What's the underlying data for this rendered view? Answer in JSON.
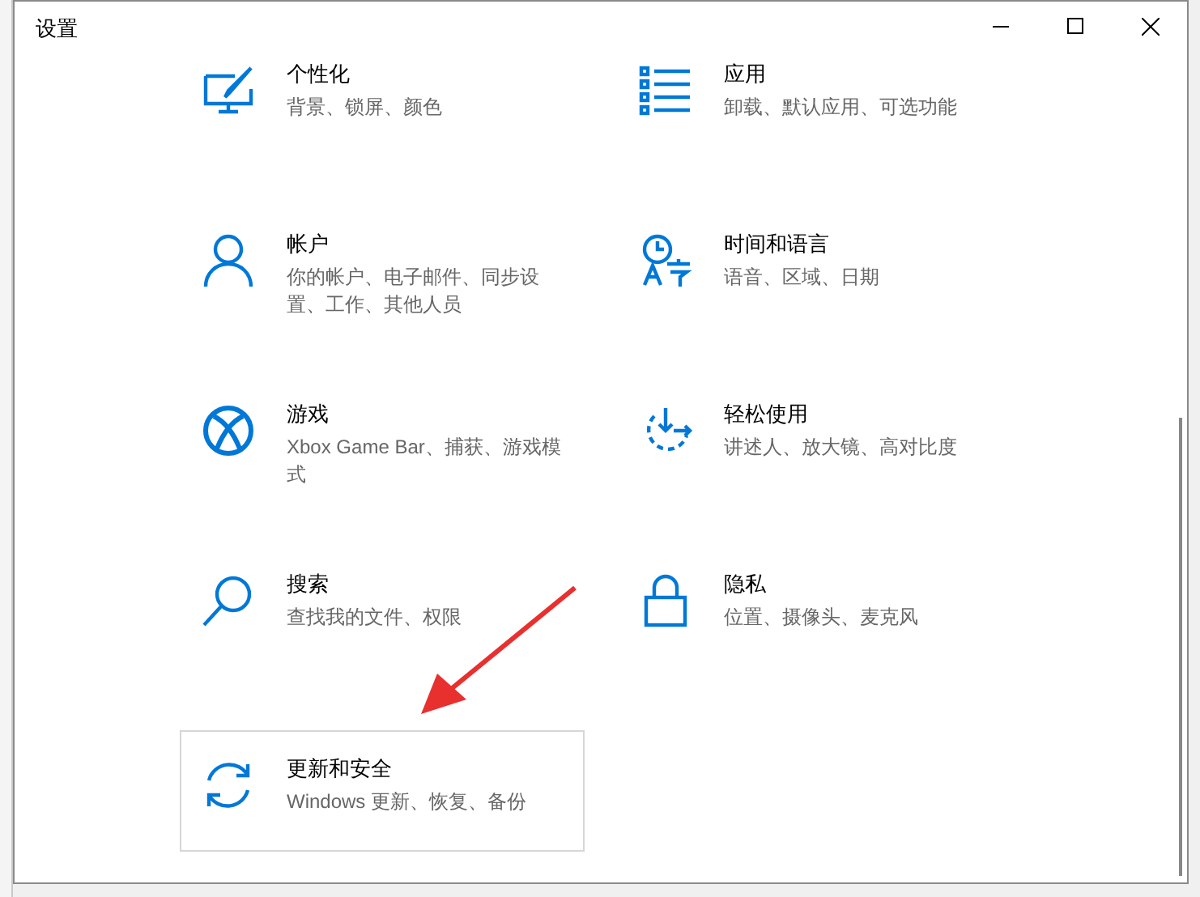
{
  "window": {
    "title": "设置"
  },
  "tiles": [
    {
      "title": "个性化",
      "description": "背景、锁屏、颜色",
      "selected": false
    },
    {
      "title": "应用",
      "description": "卸载、默认应用、可选功能",
      "selected": false
    },
    {
      "title": "帐户",
      "description": "你的帐户、电子邮件、同步设置、工作、其他人员",
      "selected": false
    },
    {
      "title": "时间和语言",
      "description": "语音、区域、日期",
      "selected": false
    },
    {
      "title": "游戏",
      "description": "Xbox Game Bar、捕获、游戏模式",
      "selected": false
    },
    {
      "title": "轻松使用",
      "description": "讲述人、放大镜、高对比度",
      "selected": false
    },
    {
      "title": "搜索",
      "description": "查找我的文件、权限",
      "selected": false
    },
    {
      "title": "隐私",
      "description": "位置、摄像头、麦克风",
      "selected": false
    },
    {
      "title": "更新和安全",
      "description": "Windows 更新、恢复、备份",
      "selected": true
    }
  ]
}
